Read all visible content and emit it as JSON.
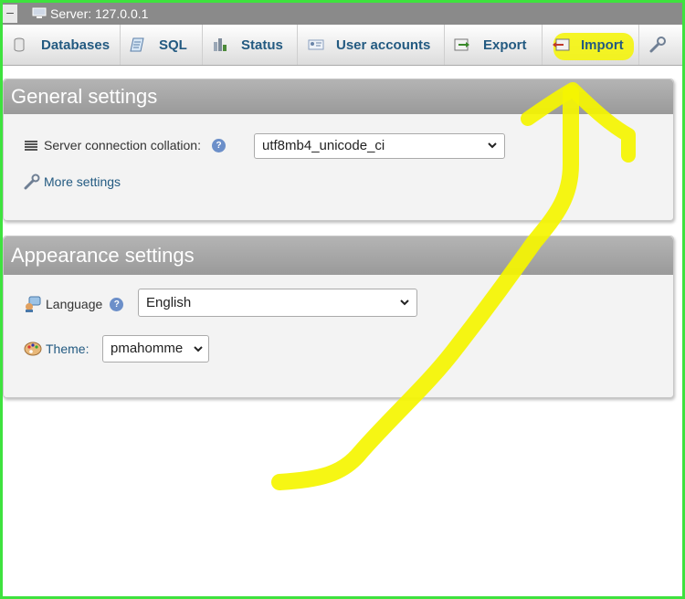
{
  "topbar": {
    "collapse": "–",
    "title": "Server: 127.0.0.1"
  },
  "tabs": [
    {
      "label": "Databases"
    },
    {
      "label": "SQL"
    },
    {
      "label": "Status"
    },
    {
      "label": "User accounts"
    },
    {
      "label": "Export"
    },
    {
      "label": "Import"
    }
  ],
  "general": {
    "heading": "General settings",
    "collation_label": "Server connection collation:",
    "collation_value": "utf8mb4_unicode_ci",
    "more_settings": "More settings"
  },
  "appearance": {
    "heading": "Appearance settings",
    "language_label": "Language",
    "language_value": "English",
    "theme_label": "Theme:",
    "theme_value": "pmahomme"
  },
  "help_glyph": "?",
  "colors": {
    "accent": "#235a81",
    "highlight": "#f5f500",
    "frame": "#3ee23e"
  }
}
